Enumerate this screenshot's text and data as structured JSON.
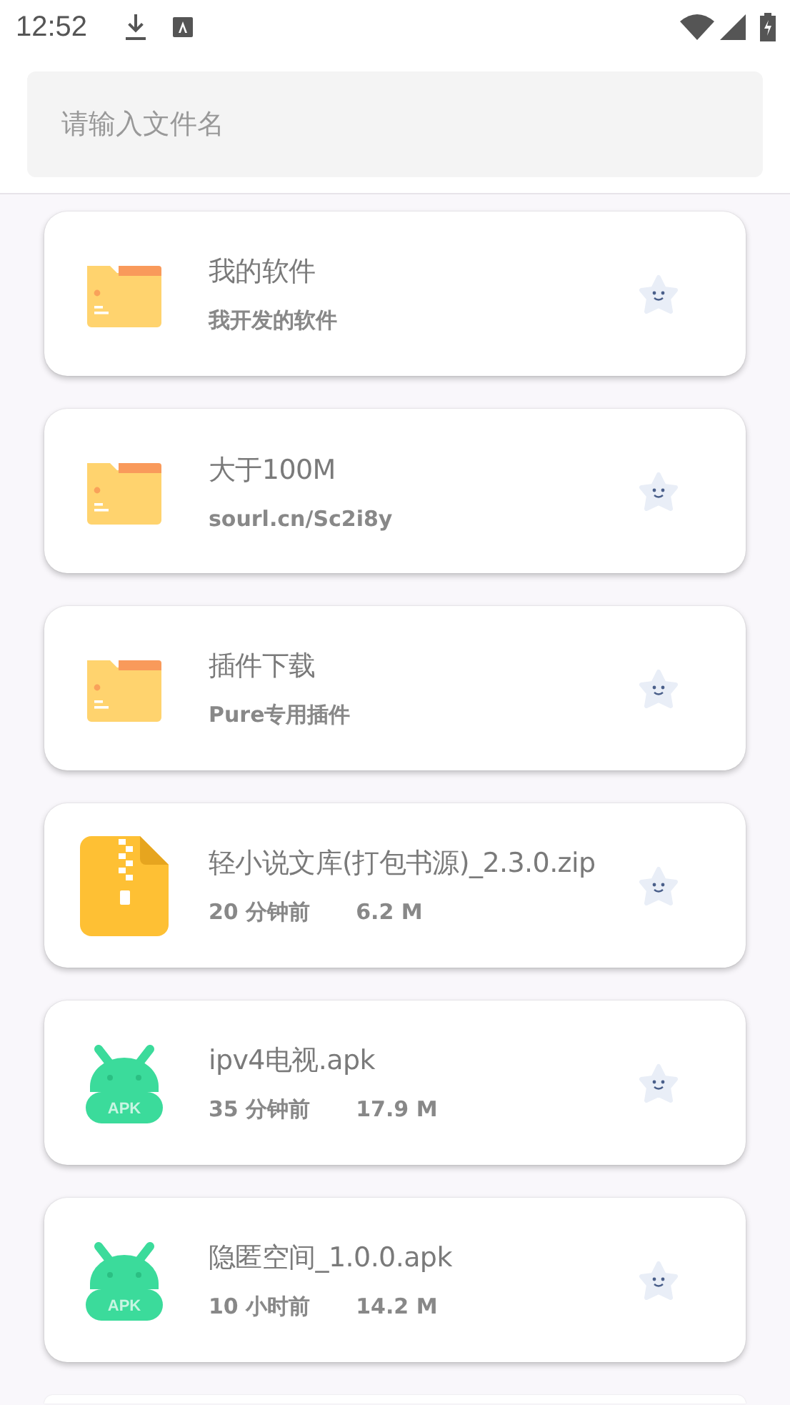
{
  "status_bar": {
    "time": "12:52"
  },
  "search": {
    "placeholder": "请输入文件名"
  },
  "files": [
    {
      "kind": "folder",
      "name": "我的软件",
      "subtitle": "我开发的软件"
    },
    {
      "kind": "folder",
      "name": "大于100M",
      "subtitle": "sourl.cn/Sc2i8y"
    },
    {
      "kind": "folder",
      "name": "插件下载",
      "subtitle": "Pure专用插件"
    },
    {
      "kind": "zip",
      "name": "轻小说文库(打包书源)_2.3.0.zip",
      "time": "20 分钟前",
      "size": "6.2 M"
    },
    {
      "kind": "apk",
      "name": "ipv4电视.apk",
      "time": "35 分钟前",
      "size": "17.9 M",
      "icon_label": "APK"
    },
    {
      "kind": "apk",
      "name": "隐匿空间_1.0.0.apk",
      "time": "10 小时前",
      "size": "14.2 M",
      "icon_label": "APK"
    }
  ]
}
